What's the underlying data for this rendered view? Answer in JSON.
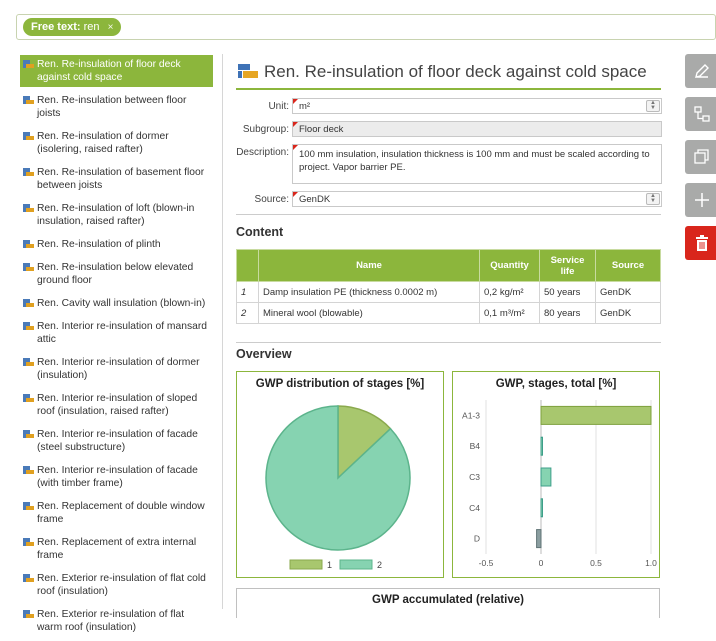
{
  "filter": {
    "label": "Free text:",
    "value": "ren",
    "close": "×"
  },
  "sidebar": {
    "items": [
      {
        "label": "Ren. Re-insulation of floor deck against cold space",
        "active": true
      },
      {
        "label": "Ren. Re-insulation between floor joists"
      },
      {
        "label": "Ren. Re-insulation of dormer (isolering, raised rafter)"
      },
      {
        "label": "Ren. Re-insulation of basement floor between joists"
      },
      {
        "label": "Ren. Re-insulation of loft (blown-in insulation, raised rafter)"
      },
      {
        "label": "Ren. Re-insulation of plinth"
      },
      {
        "label": "Ren. Re-insulation below elevated ground floor"
      },
      {
        "label": "Ren. Cavity wall insulation (blown-in)"
      },
      {
        "label": "Ren. Interior re-insulation of mansard attic"
      },
      {
        "label": "Ren. Interior re-insulation of dormer (insulation)"
      },
      {
        "label": "Ren. Interior re-insulation of sloped roof (insulation, raised rafter)"
      },
      {
        "label": "Ren. Interior re-insulation of facade (steel substructure)"
      },
      {
        "label": "Ren. Interior re-insulation of facade (with timber frame)"
      },
      {
        "label": "Ren. Replacement of double window frame"
      },
      {
        "label": "Ren. Replacement of extra internal frame"
      },
      {
        "label": "Ren. Exterior re-insulation of flat cold roof (insulation)"
      },
      {
        "label": "Ren. Exterior re-insulation of flat warm roof (insulation)"
      }
    ]
  },
  "detail": {
    "title": "Ren. Re-insulation of floor deck against cold space",
    "unit_label": "Unit:",
    "unit_value": "m²",
    "subgroup_label": "Subgroup:",
    "subgroup_value": "Floor deck",
    "description_label": "Description:",
    "description_value": "100 mm insulation, insulation thickness is 100 mm and must be scaled according to project. Vapor barrier PE.",
    "source_label": "Source:",
    "source_value": "GenDK"
  },
  "content": {
    "heading": "Content",
    "columns": [
      "",
      "Name",
      "Quantity",
      "Service life",
      "Source"
    ],
    "rows": [
      {
        "idx": "1",
        "name": "Damp insulation PE (thickness 0.0002 m)",
        "quantity": "0,2 kg/m²",
        "life": "50 years",
        "source": "GenDK"
      },
      {
        "idx": "2",
        "name": "Mineral wool (blowable)",
        "quantity": "0,1 m³/m²",
        "life": "80 years",
        "source": "GenDK"
      }
    ]
  },
  "overview": {
    "heading": "Overview"
  },
  "colors": {
    "accent": "#8cb63c",
    "series1": "#a8c76e",
    "series2": "#86d3b1",
    "danger": "#d9261c"
  },
  "chart_data": [
    {
      "type": "pie",
      "title": "GWP distribution of stages [%]",
      "series": [
        {
          "name": "1",
          "value": 13
        },
        {
          "name": "2",
          "value": 87
        }
      ]
    },
    {
      "type": "bar",
      "orientation": "horizontal",
      "title": "GWP, stages, total [%]",
      "categories": [
        "A1-3",
        "B4",
        "C3",
        "C4",
        "D"
      ],
      "values": [
        1.0,
        0.01,
        0.09,
        0.01,
        -0.04
      ],
      "xlim": [
        -0.5,
        1.0
      ],
      "xticks": [
        "-0.5",
        "0",
        "0.5",
        "1.0"
      ]
    }
  ],
  "accumulated": {
    "title": "GWP accumulated (relative)"
  },
  "tools": [
    "pencil-icon",
    "tree-icon",
    "copy-icon",
    "plus-icon",
    "trash-icon"
  ]
}
